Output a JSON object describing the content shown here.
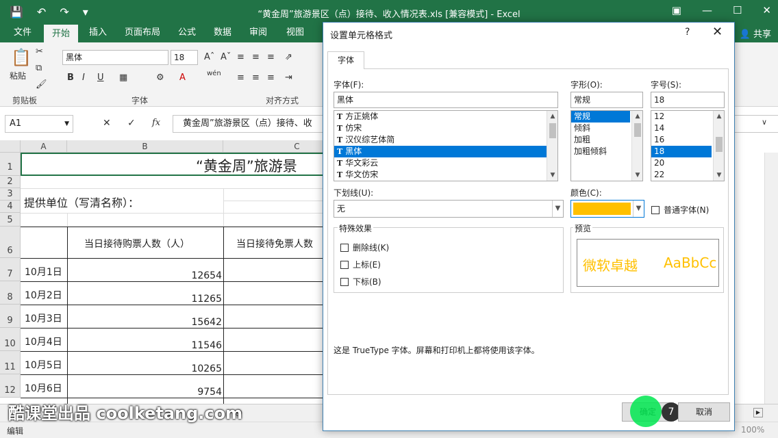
{
  "window": {
    "title": "“黄金周”旅游景区（点）接待、收入情况表.xls  [兼容模式] - Excel",
    "share": "共享"
  },
  "tabs": [
    "文件",
    "开始",
    "插入",
    "页面布局",
    "公式",
    "数据",
    "审阅",
    "视图"
  ],
  "ribbon": {
    "paste_label": "粘贴",
    "clipboard_label": "剪贴板",
    "font_name": "黑体",
    "font_size": "18",
    "font_group_label": "字体",
    "align_group_label": "对齐方式",
    "bold": "B",
    "italic": "I",
    "underline": "U",
    "phonetic": "wén"
  },
  "formula_bar": {
    "name_box": "A1",
    "fx": "fx",
    "content": "黄金周”旅游景区（点）接待、收"
  },
  "sheet": {
    "columns": [
      "A",
      "B",
      "C"
    ],
    "rows": [
      "1",
      "2",
      "3",
      "4",
      "5",
      "6",
      "7",
      "8",
      "9",
      "10",
      "11",
      "12"
    ],
    "title": "“黄金周”旅游景",
    "provider": "提供单位（写清名称）：",
    "header_b": "当日接待购票人数（人）",
    "header_c": "当日接待免票人数",
    "data_rows": [
      {
        "date": "10月1日",
        "value": "12654"
      },
      {
        "date": "10月2日",
        "value": "11265"
      },
      {
        "date": "10月3日",
        "value": "15642"
      },
      {
        "date": "10月4日",
        "value": "11546"
      },
      {
        "date": "10月5日",
        "value": "10265"
      },
      {
        "date": "10月6日",
        "value": "9754"
      }
    ]
  },
  "watermark": "酷课堂出品 coolketang.com",
  "status": {
    "mode": "编辑",
    "zoom": "100%"
  },
  "dialog": {
    "title": "设置单元格格式",
    "help": "?",
    "close": "✕",
    "tab": "字体",
    "font_label": "字体(F):",
    "font_value": "黑体",
    "font_list": [
      "方正姚体",
      "仿宋",
      "汉仪综艺体简",
      "黑体",
      "华文彩云",
      "华文仿宋"
    ],
    "font_selected": 3,
    "style_label": "字形(O):",
    "style_value": "常规",
    "style_list": [
      "常规",
      "倾斜",
      "加粗",
      "加粗倾斜"
    ],
    "style_selected": 0,
    "size_label": "字号(S):",
    "size_value": "18",
    "size_list": [
      "12",
      "14",
      "16",
      "18",
      "20",
      "22"
    ],
    "size_selected": 3,
    "underline_label": "下划线(U):",
    "underline_value": "无",
    "color_label": "颜色(C):",
    "color_value": "#ffc000",
    "normal_font_label": "普通字体(N)",
    "effects_label": "特殊效果",
    "strike_label": "删除线(K)",
    "super_label": "上标(E)",
    "sub_label": "下标(B)",
    "preview_label": "预览",
    "preview_text_cn": "微软卓越",
    "preview_text_en": "AaBbCc",
    "info": "这是 TrueType 字体。屏幕和打印机上都将使用该字体。",
    "ok": "确定",
    "cancel": "取消",
    "step_badge": "7"
  }
}
